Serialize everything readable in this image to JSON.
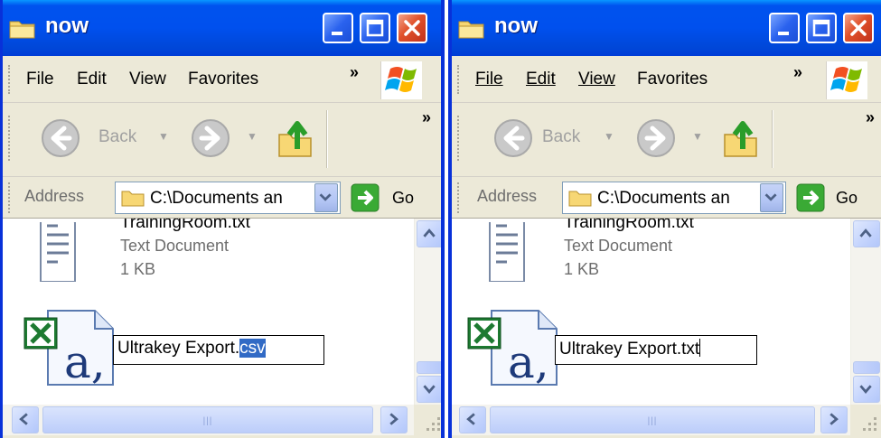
{
  "colors": {
    "title_blue": "#0053ee",
    "close_red": "#e0512a",
    "selection": "#316ac5"
  },
  "windows": [
    {
      "title": "now",
      "menu": [
        "File",
        "Edit",
        "View",
        "Favorites"
      ],
      "menu_more": "»",
      "toolbar": {
        "back_label": "Back",
        "more": "»"
      },
      "address": {
        "label": "Address",
        "path": "C:\\Documents an",
        "go_label": "Go"
      },
      "files": [
        {
          "name": "TrainingRoom.txt",
          "type": "Text Document",
          "size": "1 KB",
          "icon": "text-file-icon"
        }
      ],
      "rename": {
        "base": "Ultrakey Export.",
        "selected_ext": "csv",
        "icon": "excel-csv-icon"
      },
      "hscroll_grip": "|||"
    },
    {
      "title": "now",
      "menu": [
        "File",
        "Edit",
        "View",
        "Favorites"
      ],
      "menu_more": "»",
      "toolbar": {
        "back_label": "Back",
        "more": "»"
      },
      "address": {
        "label": "Address",
        "path": "C:\\Documents an",
        "go_label": "Go"
      },
      "files": [
        {
          "name": "TrainingRoom.txt",
          "type": "Text Document",
          "size": "1 KB",
          "icon": "text-file-icon"
        }
      ],
      "rename": {
        "value": "Ultrakey Export.txt",
        "icon": "excel-csv-icon"
      },
      "hscroll_grip": "|||"
    }
  ]
}
